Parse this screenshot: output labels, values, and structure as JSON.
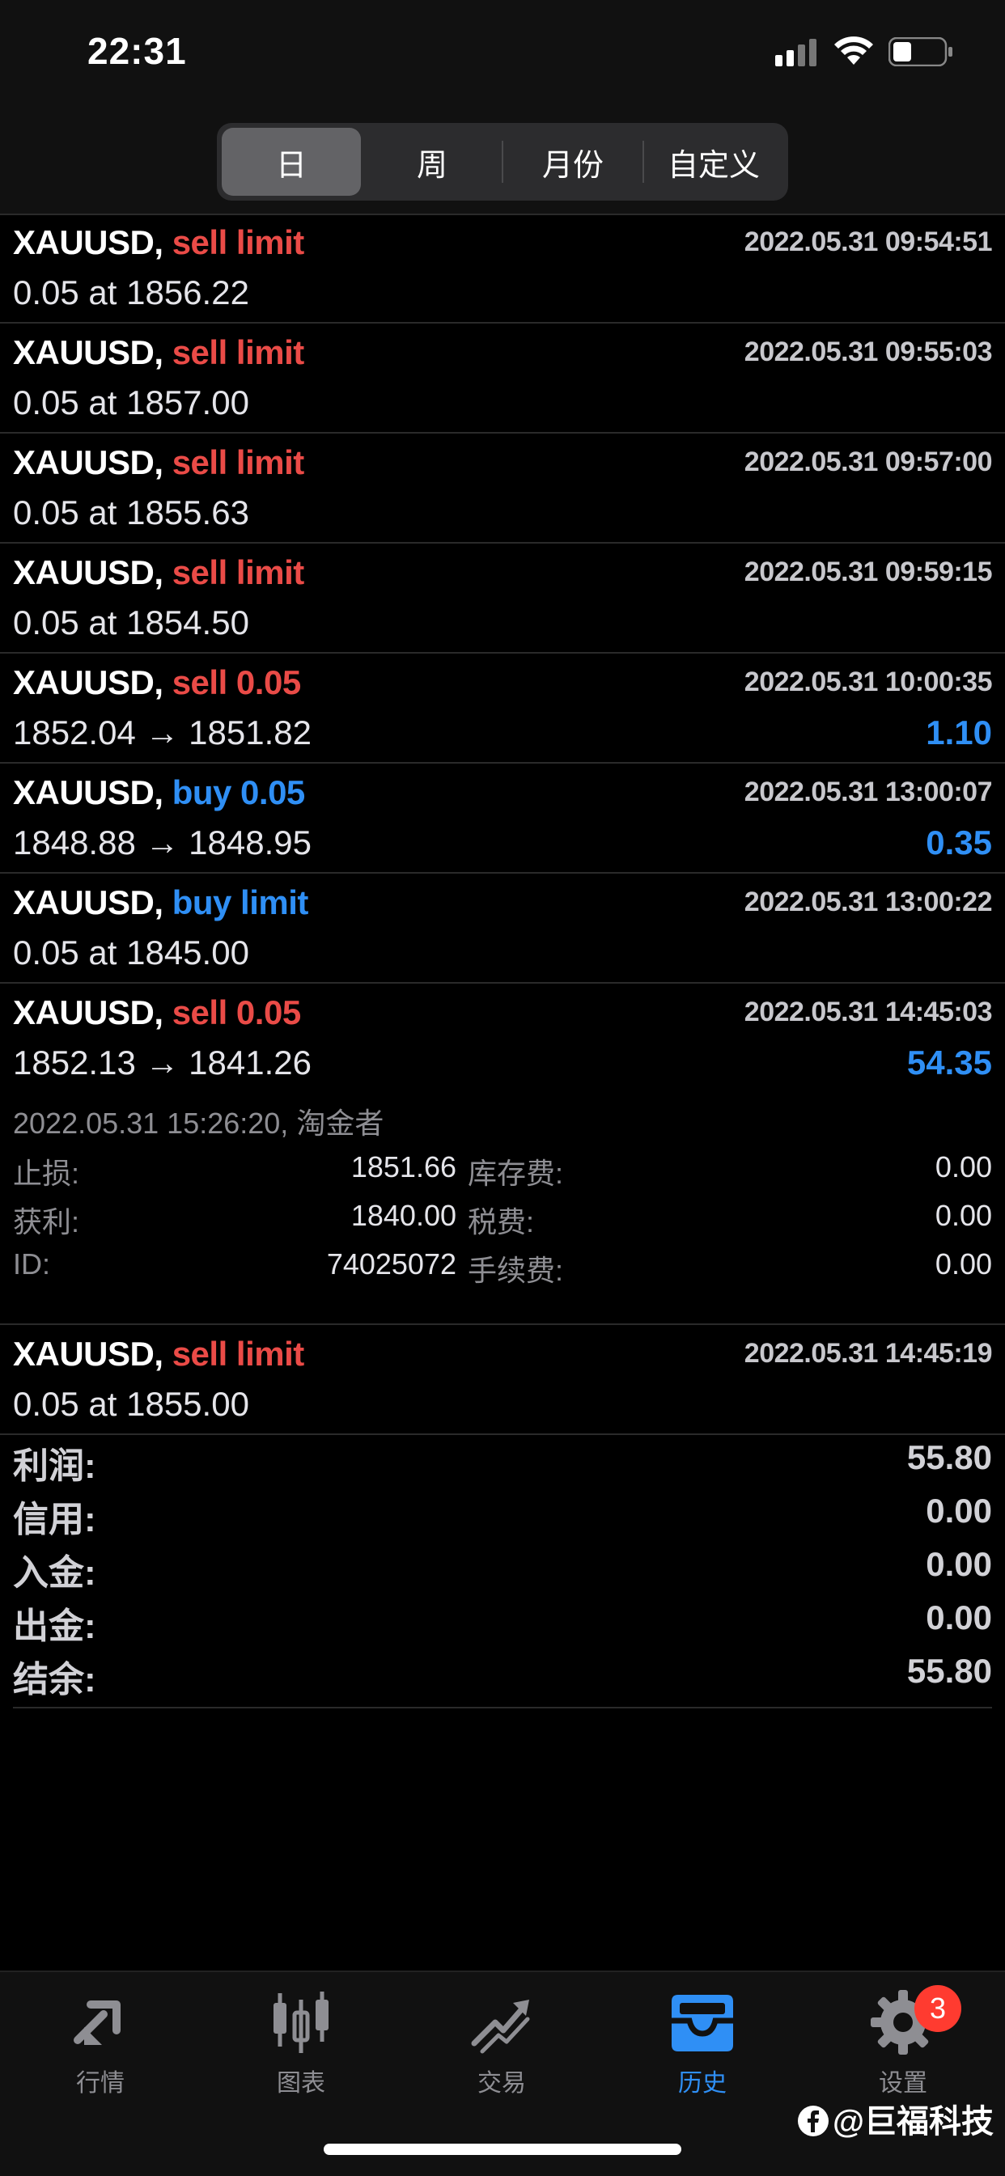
{
  "status_bar": {
    "time": "22:31"
  },
  "tabs_period": [
    {
      "label": "日",
      "active": true
    },
    {
      "label": "周",
      "active": false
    },
    {
      "label": "月份",
      "active": false
    },
    {
      "label": "自定义",
      "active": false
    }
  ],
  "orders": [
    {
      "symbol": "XAUUSD,",
      "type": "sell limit",
      "side": "sell",
      "time": "2022.05.31 09:54:51",
      "price": "0.05 at 1856.22",
      "profit": ""
    },
    {
      "symbol": "XAUUSD,",
      "type": "sell limit",
      "side": "sell",
      "time": "2022.05.31 09:55:03",
      "price": "0.05 at 1857.00",
      "profit": ""
    },
    {
      "symbol": "XAUUSD,",
      "type": "sell limit",
      "side": "sell",
      "time": "2022.05.31 09:57:00",
      "price": "0.05 at 1855.63",
      "profit": ""
    },
    {
      "symbol": "XAUUSD,",
      "type": "sell limit",
      "side": "sell",
      "time": "2022.05.31 09:59:15",
      "price": "0.05 at 1854.50",
      "profit": ""
    },
    {
      "symbol": "XAUUSD,",
      "type": "sell 0.05",
      "side": "sell",
      "time": "2022.05.31 10:00:35",
      "price": "1852.04 → 1851.82",
      "profit": "1.10"
    },
    {
      "symbol": "XAUUSD,",
      "type": "buy 0.05",
      "side": "buy",
      "time": "2022.05.31 13:00:07",
      "price": "1848.88 → 1848.95",
      "profit": "0.35"
    },
    {
      "symbol": "XAUUSD,",
      "type": "buy limit",
      "side": "buy",
      "time": "2022.05.31 13:00:22",
      "price": "0.05 at 1845.00",
      "profit": ""
    }
  ],
  "expanded_order": {
    "symbol": "XAUUSD,",
    "type": "sell 0.05",
    "time": "2022.05.31 14:45:03",
    "price": "1852.13 → 1841.26",
    "profit": "54.35",
    "detail_time": "2022.05.31 15:26:20, 淘金者",
    "stop_loss_label": "止损:",
    "stop_loss": "1851.66",
    "take_profit_label": "获利:",
    "take_profit": "1840.00",
    "id_label": "ID:",
    "id": "74025072",
    "swap_label": "库存费:",
    "swap": "0.00",
    "tax_label": "税费:",
    "tax": "0.00",
    "commission_label": "手续费:",
    "commission": "0.00"
  },
  "last_order": {
    "symbol": "XAUUSD,",
    "type": "sell limit",
    "side": "sell",
    "time": "2022.05.31 14:45:19",
    "price": "0.05 at 1855.00"
  },
  "summary": [
    {
      "label": "利润:",
      "value": "55.80"
    },
    {
      "label": "信用:",
      "value": "0.00"
    },
    {
      "label": "入金:",
      "value": "0.00"
    },
    {
      "label": "出金:",
      "value": "0.00"
    },
    {
      "label": "结余:",
      "value": "55.80"
    }
  ],
  "tab_bar": {
    "quotes": "行情",
    "charts": "图表",
    "trade": "交易",
    "history": "历史",
    "settings": "设置",
    "settings_badge": "3",
    "active_color": "#2f8ff5"
  },
  "watermark": "@巨福科技"
}
